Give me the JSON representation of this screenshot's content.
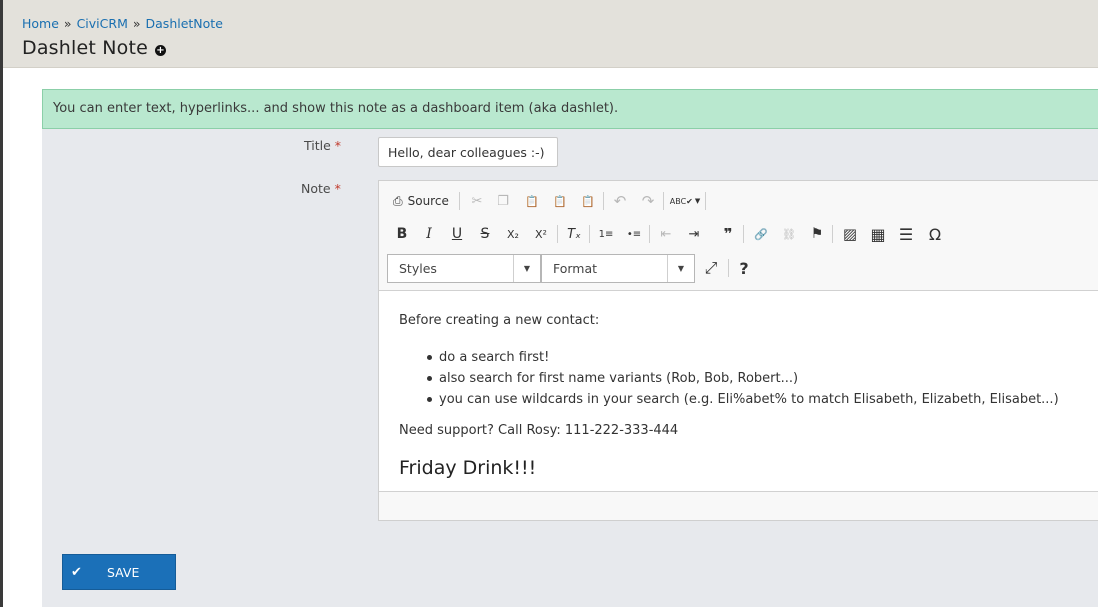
{
  "breadcrumb": {
    "home": "Home",
    "civicrm": "CiviCRM",
    "dashletnote": "DashletNote",
    "separator": "»"
  },
  "page_title": "Dashlet Note",
  "help_text": "You can enter text, hyperlinks... and show this note as a dashboard item (aka dashlet).",
  "form": {
    "title_label": "Title",
    "title_value": "Hello, dear colleagues :-)",
    "note_label": "Note",
    "required_marker": "*"
  },
  "toolbar": {
    "source_label": "Source",
    "styles_label": "Styles",
    "format_label": "Format",
    "help_label": "?",
    "icons": {
      "source": "⎙",
      "cut": "✂",
      "copy": "❐",
      "paste": "📋",
      "paste_text": "📋",
      "paste_word": "📋",
      "undo": "↶",
      "redo": "↷",
      "spellcheck": "ABC✔",
      "bold": "B",
      "italic": "I",
      "underline": "U",
      "strike": "S",
      "subscript": "X₂",
      "superscript": "X²",
      "remove_format": "Tₓ",
      "numbered_list": "1≡",
      "bulleted_list": "•≡",
      "outdent": "⇤",
      "indent": "⇥",
      "blockquote": "❞",
      "link": "🔗",
      "unlink": "⛓",
      "anchor": "⚑",
      "image": "▨",
      "table": "▦",
      "hr": "☰",
      "special_char": "Ω",
      "maximize": "⤢"
    }
  },
  "note_body": {
    "intro": "Before creating a new contact:",
    "items": [
      "do a search first!",
      "also search for first name variants (Rob, Bob, Robert...)",
      "you can use wildcards in your search (e.g. Eli%abet% to match Elisabeth, Elizabeth, Elisabet...)"
    ],
    "support": "Need support? Call Rosy: 111-222-333-444",
    "heading": "Friday Drink!!!"
  },
  "save_label": "SAVE",
  "colors": {
    "accent": "#1b70b8",
    "help_bg": "#b9e8cf",
    "header_bg": "#e3e1db",
    "content_bg": "#e7e9ed"
  }
}
